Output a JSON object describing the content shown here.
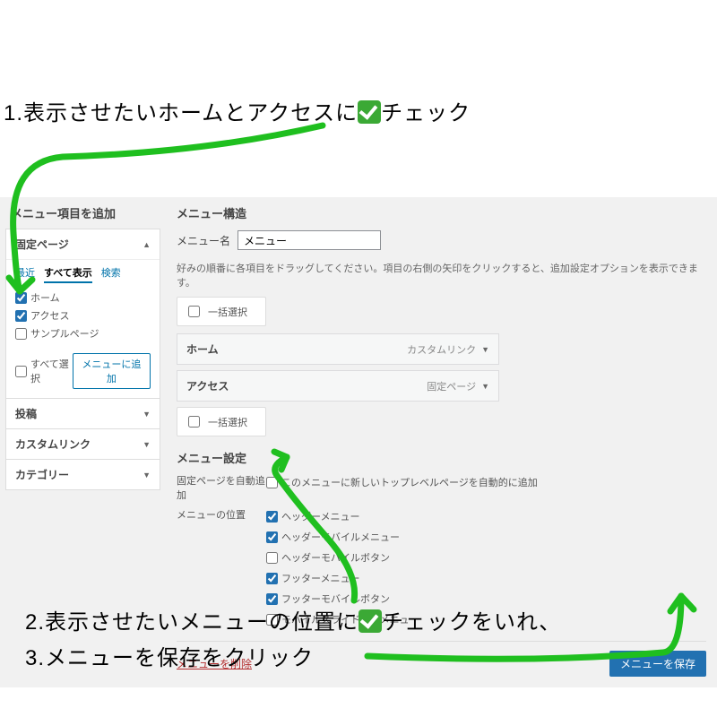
{
  "annotations": {
    "a1": "1.表示させたいホームとアクセスに",
    "a1b": "チェック",
    "a2": "2.表示させたいメニューの位置に",
    "a2b": "チェックをいれ、",
    "a3": "3.メニューを保存をクリック"
  },
  "left": {
    "title": "メニュー項目を追加",
    "sections": {
      "pages": "固定ページ",
      "posts": "投稿",
      "custom": "カスタムリンク",
      "categories": "カテゴリー"
    },
    "tabs": {
      "recent": "最近",
      "all": "すべて表示",
      "search": "検索"
    },
    "items": {
      "home": "ホーム",
      "access": "アクセス",
      "sample": "サンプルページ"
    },
    "select_all": "すべて選択",
    "add_btn": "メニューに追加"
  },
  "right": {
    "title": "メニュー構造",
    "name_label": "メニュー名",
    "name_value": "メニュー",
    "hint": "好みの順番に各項目をドラッグしてください。項目の右側の矢印をクリックすると、追加設定オプションを表示できます。",
    "bulk": "一括選択",
    "items": [
      {
        "name": "ホーム",
        "type": "カスタムリンク"
      },
      {
        "name": "アクセス",
        "type": "固定ページ"
      }
    ],
    "settings": {
      "title": "メニュー設定",
      "auto_label": "固定ページを自動追加",
      "auto_opt": "このメニューに新しいトップレベルページを自動的に追加",
      "pos_label": "メニューの位置",
      "positions": [
        {
          "label": "ヘッダーメニュー",
          "checked": true
        },
        {
          "label": "ヘッダーモバイルメニュー",
          "checked": true
        },
        {
          "label": "ヘッダーモバイルボタン",
          "checked": false
        },
        {
          "label": "フッターメニュー",
          "checked": true
        },
        {
          "label": "フッターモバイルボタン",
          "checked": true
        },
        {
          "label": "モバイルスライドインメニュー",
          "checked": false
        }
      ]
    },
    "delete": "メニューを削除",
    "save": "メニューを保存"
  }
}
